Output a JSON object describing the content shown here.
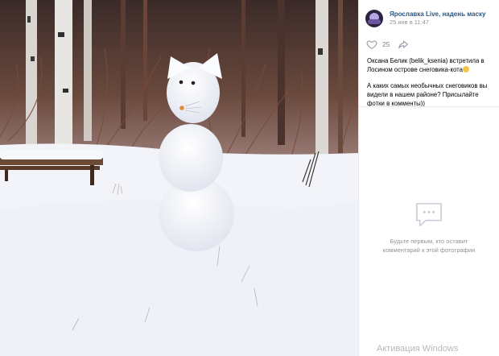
{
  "photo": {
    "description_icon": "snowman-cat-photo"
  },
  "header": {
    "author": "Ярославка Live, надень маску",
    "date": "25 янв в 11:47"
  },
  "actions": {
    "like_count": "25",
    "like_icon": "heart-icon",
    "share_icon": "share-arrow-icon"
  },
  "post": {
    "paragraph1": "Оксана Белик (belik_ksenia) встретила в Лосином острове снеговика-кота",
    "paragraph2": "А каких самых необычных снеговиков вы видели в нашем районе? Присылайте фотки в комменты))"
  },
  "comments": {
    "empty_line1": "Будьте первым, кто оставит",
    "empty_line2": "комментарий к этой фотографии"
  },
  "watermark": "Активация Windows",
  "colors": {
    "link": "#2a5885",
    "muted": "#939393",
    "divider": "#e7e8ec"
  }
}
